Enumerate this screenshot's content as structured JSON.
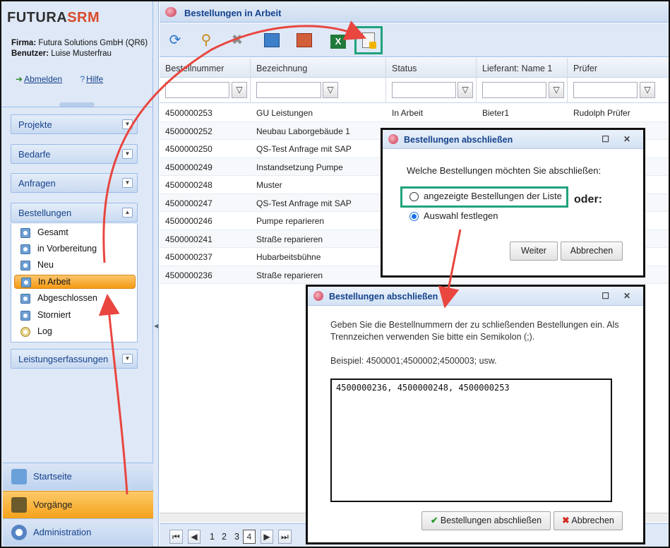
{
  "brand": {
    "part1": "FUTURA",
    "part2": "SRM"
  },
  "account": {
    "firma_label": "Firma:",
    "firma": "Futura Solutions GmbH (QR6)",
    "benutzer_label": "Benutzer:",
    "benutzer": "Luise Musterfrau"
  },
  "top_links": {
    "logout": "Abmelden",
    "help": "Hilfe"
  },
  "accordion": [
    {
      "label": "Projekte"
    },
    {
      "label": "Bedarfe"
    },
    {
      "label": "Anfragen"
    },
    {
      "label": "Bestellungen"
    },
    {
      "label": "Leistungserfassungen"
    }
  ],
  "bestellungen_items": [
    "Gesamt",
    "in Vorbereitung",
    "Neu",
    "In Arbeit",
    "Abgeschlossen",
    "Storniert",
    "Log"
  ],
  "selected_item": "In Arbeit",
  "bottom_nav": [
    {
      "label": "Startseite"
    },
    {
      "label": "Vorgänge"
    },
    {
      "label": "Administration"
    }
  ],
  "main": {
    "title": "Bestellungen in Arbeit"
  },
  "toolbar": {
    "icons": [
      "refresh-icon",
      "search-icon",
      "delete-icon",
      "export-icon",
      "settings-export-icon",
      "excel-icon",
      "close-order-icon"
    ]
  },
  "grid": {
    "columns": [
      "Bestellnummer",
      "Bezeichnung",
      "Status",
      "Lieferant: Name 1",
      "Prüfer"
    ],
    "rows": [
      [
        "4500000253",
        "GU Leistungen",
        "In Arbeit",
        "Bieter1",
        "Rudolph Prüfer"
      ],
      [
        "4500000252",
        "Neubau Laborgebäude 1",
        "",
        "",
        ""
      ],
      [
        "4500000250",
        "QS-Test Anfrage mit SAP",
        "",
        "",
        ""
      ],
      [
        "4500000249",
        "Instandsetzung Pumpe",
        "",
        "",
        ""
      ],
      [
        "4500000248",
        "Muster",
        "",
        "",
        ""
      ],
      [
        "4500000247",
        "QS-Test Anfrage mit SAP",
        "",
        "",
        ""
      ],
      [
        "4500000246",
        "Pumpe reparieren",
        "",
        "",
        ""
      ],
      [
        "4500000241",
        "Straße reparieren",
        "",
        "",
        ""
      ],
      [
        "4500000237",
        "Hubarbeitsbühne",
        "",
        "",
        ""
      ],
      [
        "4500000236",
        "Straße reparieren",
        "",
        "",
        ""
      ]
    ]
  },
  "pager": {
    "pages": [
      "1",
      "2",
      "3",
      "4"
    ],
    "current": "4"
  },
  "dialog1": {
    "title": "Bestellungen abschließen",
    "question": "Welche Bestellungen möchten Sie abschließen:",
    "option1": "angezeigte Bestellungen der Liste",
    "option2": "Auswahl festlegen",
    "oder": "oder:",
    "btn_next": "Weiter",
    "btn_cancel": "Abbrechen"
  },
  "dialog2": {
    "title": "Bestellungen abschließen",
    "instruction": "Geben Sie die Bestellnummern der zu schließenden Bestellungen ein. Als Trennzeichen verwenden Sie bitte ein Semikolon (;).",
    "example": "Beispiel: 4500001;4500002;4500003; usw.",
    "input_value": "4500000236, 4500000248, 4500000253",
    "btn_confirm": "Bestellungen abschließen",
    "btn_cancel": "Abbrechen"
  },
  "colors": {
    "accent": "#f49a14",
    "brand_red": "#d94a2b",
    "highlight_green": "#21a27c",
    "arrow_red": "#e8463f"
  }
}
